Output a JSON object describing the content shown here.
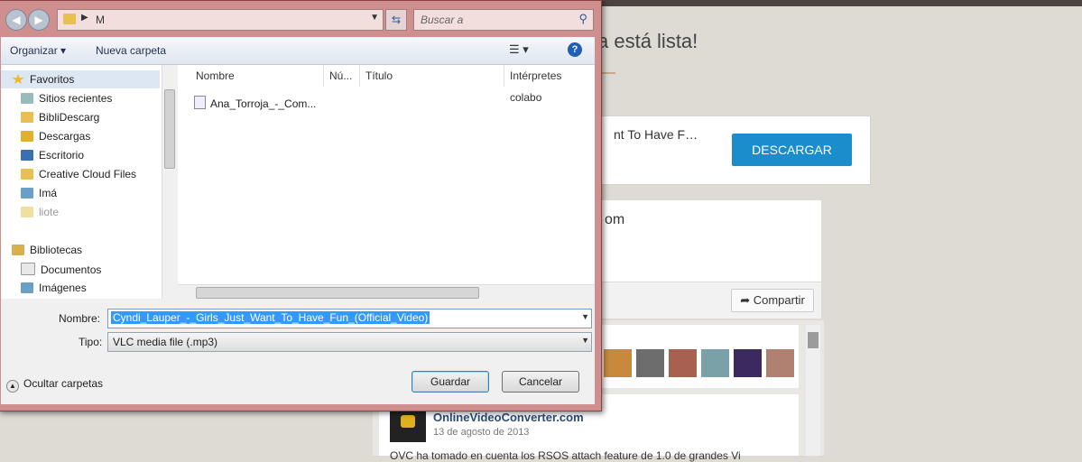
{
  "background": {
    "heading": "a está lista!",
    "card_title": "nt To Have F…",
    "download_button": "DESCARGAR",
    "card2_text": "om",
    "share_button": "Compartir",
    "share_icon": "share-arrow-icon",
    "avatar_colors": [
      "#c88a3a",
      "#6d6d6d",
      "#a86050",
      "#7aa0a8",
      "#3a2a60",
      "#b08070"
    ],
    "post": {
      "author": "OnlineVideoConverter.com",
      "date": "13 de agosto de 2013",
      "text": "OVC ha tomado en cuenta los RSOS attach feature de 1.0 de grandes Vi"
    },
    "colors": {
      "download": "#1b8ccc",
      "top_bar": "#4a4440"
    }
  },
  "dialog": {
    "address": {
      "path_text": "M",
      "search_placeholder": "Buscar a"
    },
    "toolbar": {
      "organize": "Organizar",
      "new_folder": "Nueva carpeta",
      "view_icon": "view-list-icon",
      "help": "?"
    },
    "nav": {
      "items": [
        {
          "label": "Favoritos",
          "icon": "star-icon"
        },
        {
          "label": "Sitios recientes",
          "icon": "recent-places-icon"
        },
        {
          "label": "BibliDescarg",
          "icon": "folder-icon"
        },
        {
          "label": "Descargas",
          "icon": "downloads-folder-icon"
        },
        {
          "label": "Escritorio",
          "icon": "desktop-icon"
        },
        {
          "label": "Creative Cloud Files",
          "icon": "folder-icon"
        },
        {
          "label": "Imá",
          "icon": "images-icon"
        },
        {
          "label": "liote",
          "icon": "folder-icon"
        },
        {
          "label": "Bibliotecas",
          "icon": "libraries-icon"
        },
        {
          "label": "Documentos",
          "icon": "documents-icon"
        },
        {
          "label": "Imágenes",
          "icon": "images-icon"
        }
      ]
    },
    "columns": [
      "Nombre",
      "Nú...",
      "Título",
      "Intérpretes colabo"
    ],
    "files": [
      {
        "name": "Ana_Torroja_-_Com..."
      }
    ],
    "filename_label": "Nombre:",
    "filename_value": "Cyndi_Lauper_-_Girls_Just_Want_To_Have_Fun_(Official_Video)",
    "filetype_label": "Tipo:",
    "filetype_value": "VLC media file (.mp3)",
    "hide_folders": "Ocultar carpetas",
    "save_button": "Guardar",
    "cancel_button": "Cancelar"
  }
}
